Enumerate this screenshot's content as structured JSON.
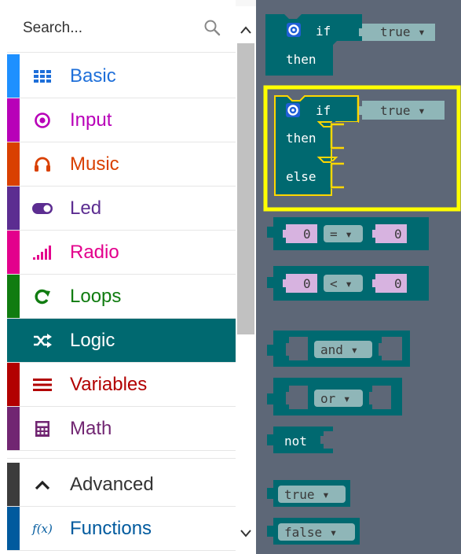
{
  "search": {
    "placeholder": "Search..."
  },
  "categories": [
    {
      "label": "Basic",
      "icon": "grid-icon",
      "color": "#1e90ff"
    },
    {
      "label": "Input",
      "icon": "target-icon",
      "color": "#b800b8"
    },
    {
      "label": "Music",
      "icon": "headphones-icon",
      "color": "#d94000"
    },
    {
      "label": "Led",
      "icon": "toggle-icon",
      "color": "#5c2d91"
    },
    {
      "label": "Radio",
      "icon": "signal-bars-icon",
      "color": "#e3008c"
    },
    {
      "label": "Loops",
      "icon": "loop-arrow-icon",
      "color": "#107c10"
    },
    {
      "label": "Logic",
      "icon": "shuffle-icon",
      "color": "#006970",
      "selected": true
    },
    {
      "label": "Variables",
      "icon": "list-icon",
      "color": "#b20000"
    },
    {
      "label": "Math",
      "icon": "calculator-icon",
      "color": "#712672"
    },
    {
      "label": "Advanced",
      "icon": "chevron-up-icon",
      "color": "#3c3c3c"
    },
    {
      "label": "Functions",
      "icon": "function-icon",
      "color": "#005a9e"
    }
  ],
  "blocks": {
    "if_then": {
      "keyword_if": "if",
      "condition": "true ▾",
      "keyword_then": "then"
    },
    "if_then_else": {
      "keyword_if": "if",
      "condition": "true ▾",
      "keyword_then": "then",
      "keyword_else": "else"
    },
    "compare_eq": {
      "left": "0",
      "operator": "= ▾",
      "right": "0"
    },
    "compare_lt": {
      "left": "0",
      "operator": "< ▾",
      "right": "0"
    },
    "and_block": {
      "operator": "and ▾"
    },
    "or_block": {
      "operator": "or ▾"
    },
    "not_block": {
      "label": "not"
    },
    "true_block": {
      "value": "true ▾"
    },
    "false_block": {
      "value": "false ▾"
    }
  },
  "colors": {
    "logic_block": "#006970",
    "highlight": "#ffff00",
    "workspace": "#5d6777",
    "number_slot": "#d7b3e0"
  }
}
